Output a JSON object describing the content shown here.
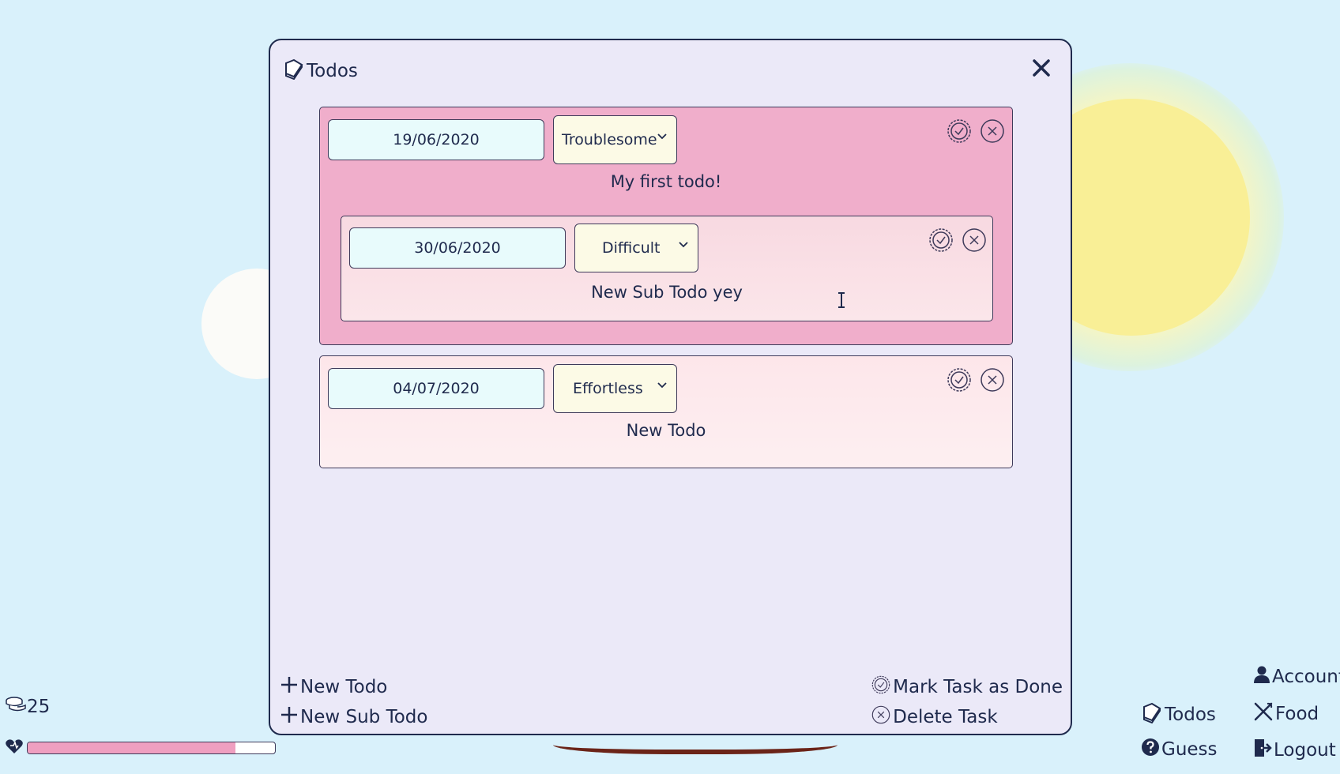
{
  "modal": {
    "title": "Todos",
    "title_icon": "book-icon",
    "close_icon": "close-icon"
  },
  "todos": [
    {
      "date": "19/06/2020",
      "difficulty": "Troublesome",
      "text": "My first todo!",
      "color": "#f0aecb",
      "subtodos": [
        {
          "date": "30/06/2020",
          "difficulty": "Difficult",
          "text": "New Sub Todo yey",
          "color": "#f8d9e1"
        }
      ]
    },
    {
      "date": "04/07/2020",
      "difficulty": "Effortless",
      "text": "New Todo",
      "color": "#fde6ea"
    }
  ],
  "footer": {
    "new_todo": "New Todo",
    "new_sub_todo": "New Sub Todo",
    "mark_done": "Mark Task as Done",
    "delete_task": "Delete Task"
  },
  "hud": {
    "coins": "25",
    "health_fraction": 0.84
  },
  "nav": {
    "account": "Account",
    "todos": "Todos",
    "food": "Food",
    "guess": "Guess",
    "logout": "Logout"
  },
  "colors": {
    "background": "#d9f1fb",
    "modal": "#ebe9f8",
    "border": "#1f2a4d",
    "date_field": "#e8fbfc",
    "select": "#fcfae6",
    "health": "#ef9fc0"
  }
}
